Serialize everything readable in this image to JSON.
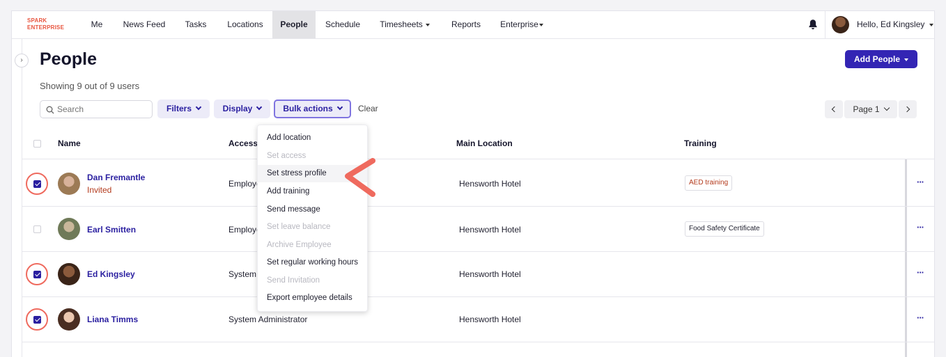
{
  "nav": {
    "logo_line1": "SPARK",
    "logo_line2": "ENTERPRISE",
    "items": [
      {
        "label": "Me"
      },
      {
        "label": "News Feed"
      },
      {
        "label": "Tasks"
      },
      {
        "label": "Locations"
      },
      {
        "label": "People",
        "active": true
      },
      {
        "label": "Schedule"
      },
      {
        "label": "Timesheets",
        "dropdown": true
      },
      {
        "label": "Reports"
      },
      {
        "label": "Enterprise",
        "dropdown": true
      }
    ],
    "user_greeting": "Hello, Ed Kingsley"
  },
  "header": {
    "title": "People",
    "showing": "Showing 9 out of 9 users",
    "add_button": "Add People"
  },
  "toolbar": {
    "search_placeholder": "Search",
    "filters": "Filters",
    "display": "Display",
    "bulk_actions": "Bulk actions",
    "clear": "Clear",
    "page_label": "Page 1"
  },
  "table": {
    "columns": [
      "Name",
      "Access",
      "Main Location",
      "Training"
    ],
    "rows": [
      {
        "name": "Dan Fremantle",
        "status": "Invited",
        "access": "Employee",
        "location": "Hensworth Hotel",
        "training": "AED training",
        "checked": true
      },
      {
        "name": "Earl Smitten",
        "status": "",
        "access": "Employee",
        "location": "Hensworth Hotel",
        "training": "Food Safety Certificate",
        "checked": false
      },
      {
        "name": "Ed Kingsley",
        "status": "",
        "access": "System Administrator",
        "location": "Hensworth Hotel",
        "training": "",
        "checked": true
      },
      {
        "name": "Liana Timms",
        "status": "",
        "access": "System Administrator",
        "location": "Hensworth Hotel",
        "training": "",
        "checked": true
      }
    ]
  },
  "bulk_menu": {
    "items": [
      {
        "label": "Add location",
        "disabled": false
      },
      {
        "label": "Set access",
        "disabled": true
      },
      {
        "label": "Set stress profile",
        "disabled": false,
        "highlighted": true
      },
      {
        "label": "Add training",
        "disabled": false
      },
      {
        "label": "Send message",
        "disabled": false
      },
      {
        "label": "Set leave balance",
        "disabled": true
      },
      {
        "label": "Archive Employee",
        "disabled": true
      },
      {
        "label": "Set regular working hours",
        "disabled": false
      },
      {
        "label": "Send Invitation",
        "disabled": true
      },
      {
        "label": "Export employee details",
        "disabled": false
      }
    ]
  },
  "colors": {
    "accent": "#3325b4",
    "logo": "#e8553f",
    "annotation": "#ef6a5e",
    "invited": "#b33a1c"
  }
}
